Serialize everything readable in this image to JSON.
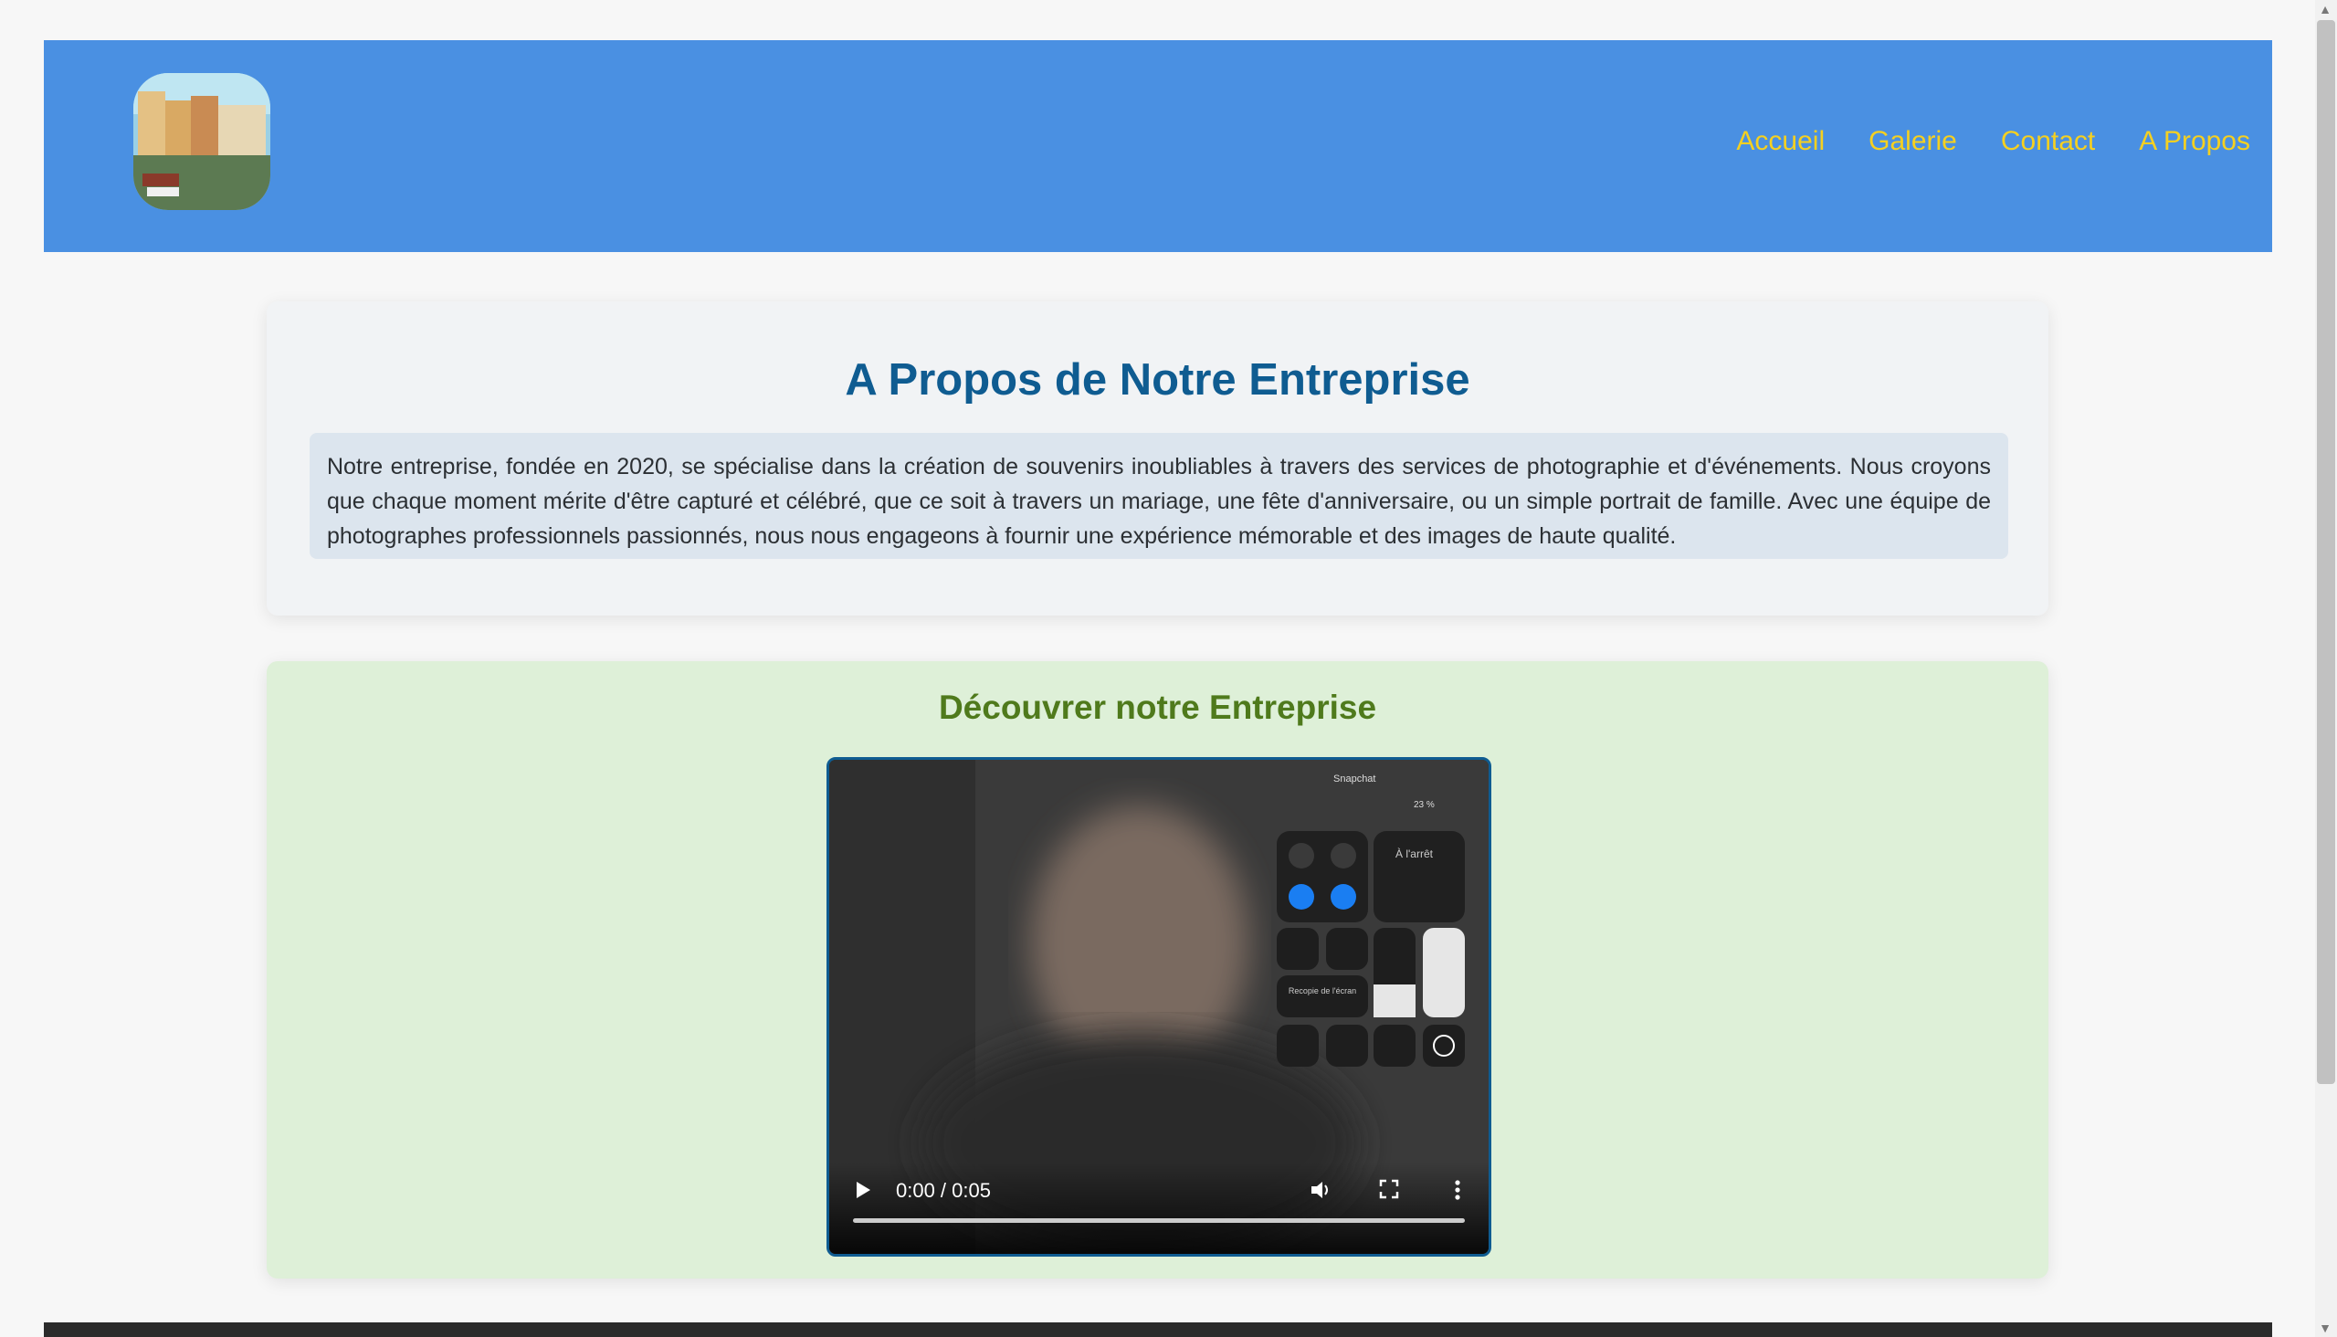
{
  "header": {
    "nav": [
      "Accueil",
      "Galerie",
      "Contact",
      "A Propos"
    ]
  },
  "about": {
    "title": "A Propos de Notre Entreprise",
    "text": "Notre entreprise, fondée en 2020, se spécialise dans la création de souvenirs inoubliables à travers des services de photographie et d'événements. Nous croyons que chaque moment mérite d'être capturé et célébré, que ce soit à travers un mariage, une fête d'anniversaire, ou un simple portrait de famille. Avec une équipe de photographes professionnels passionnés, nous nous engageons à fournir une expérience mémorable et des images de haute qualité."
  },
  "discover": {
    "title": "Découvrer notre Entreprise",
    "video_time": "0:00 / 0:05",
    "video_overlay": {
      "app": "Snapchat",
      "battery": "23 %",
      "media_status": "À l'arrêt",
      "screen_mirror": "Recopie de l'écran"
    }
  }
}
